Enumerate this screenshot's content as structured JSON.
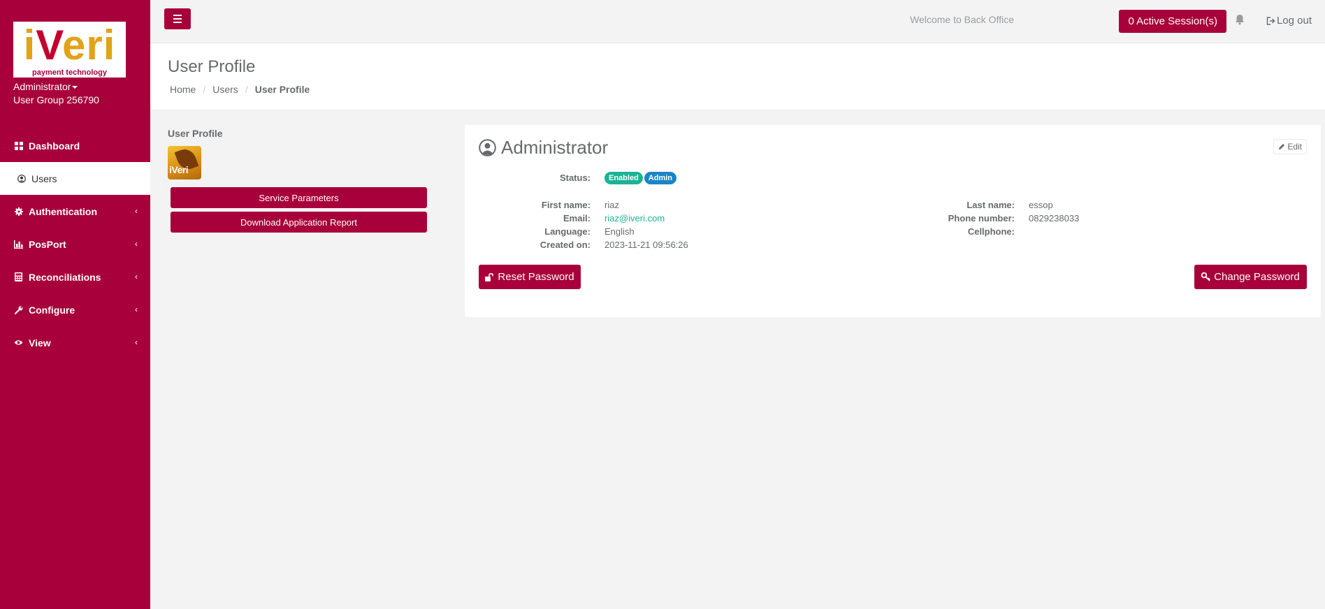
{
  "brand": {
    "logo_text_1": "i",
    "logo_text_2": "V",
    "logo_text_3": "eri",
    "tagline": "payment technology"
  },
  "user": {
    "name": "Administrator",
    "group": "User Group 256790"
  },
  "nav": [
    {
      "label": "Dashboard",
      "icon": "th-large-icon",
      "active": false
    },
    {
      "label": "Users",
      "icon": "user-circle-icon",
      "active": true
    },
    {
      "label": "Authentication",
      "icon": "gear-icon",
      "active": false,
      "has_children": true
    },
    {
      "label": "PosPort",
      "icon": "bar-chart-icon",
      "active": false,
      "has_children": true
    },
    {
      "label": "Reconciliations",
      "icon": "calculator-icon",
      "active": false,
      "has_children": true
    },
    {
      "label": "Configure",
      "icon": "wrench-icon",
      "active": false,
      "has_children": true
    },
    {
      "label": "View",
      "icon": "eye-icon",
      "active": false,
      "has_children": true
    }
  ],
  "topbar": {
    "welcome": "Welcome to Back Office",
    "sessions": "0 Active Session(s)",
    "logout": "Log out"
  },
  "heading": {
    "title": "User Profile",
    "breadcrumb": [
      "Home",
      "Users",
      "User Profile"
    ]
  },
  "left": {
    "title": "User Profile",
    "avatar_text": "iVeri",
    "buttons": [
      "Service Parameters",
      "Download Application Report"
    ]
  },
  "profile": {
    "name": "Administrator",
    "edit": "Edit",
    "status_label": "Status:",
    "badges": [
      "Enabled",
      "Admin"
    ],
    "fields_left": [
      {
        "label": "First name:",
        "value": "riaz"
      },
      {
        "label": "Email:",
        "value": "riaz@iveri.com"
      },
      {
        "label": "Language:",
        "value": "English"
      },
      {
        "label": "Created on:",
        "value": "2023-11-21 09:56:26"
      }
    ],
    "fields_right": [
      {
        "label": "Last name:",
        "value": "essop"
      },
      {
        "label": "Phone number:",
        "value": "0829238033"
      },
      {
        "label": "Cellphone:",
        "value": ""
      }
    ],
    "reset_password": "Reset Password",
    "change_password": "Change Password"
  },
  "colors": {
    "brand": "#a8003a",
    "logo_gold": "#e2a219",
    "enabled": "#1ab394",
    "admin": "#1c84c6"
  }
}
